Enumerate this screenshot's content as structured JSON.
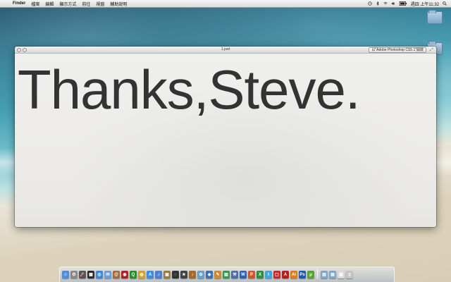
{
  "menubar": {
    "apple_glyph": "",
    "items": [
      "Finder",
      "檔案",
      "編輯",
      "顯示方式",
      "前往",
      "視窗",
      "輔助說明"
    ],
    "clock": "週四 上午11:32",
    "status_icons": [
      "wifi-icon",
      "volume-icon",
      "battery-icon",
      "bluetooth-icon",
      "time-machine-icon",
      "spotlight-icon"
    ]
  },
  "window": {
    "title": "1.psd",
    "open_with": "以\"Adobe Photoshop CS5.1\"開啟",
    "fullscreen_glyph": "⤢",
    "content_text": "Thanks,Steve."
  },
  "dock": {
    "icons": [
      {
        "name": "finder-icon",
        "color": "#4f8fd9",
        "glyph": "☺"
      },
      {
        "name": "system-preferences-icon",
        "color": "#8a8a8a",
        "glyph": "⚙"
      },
      {
        "name": "launchpad-icon",
        "color": "#555555",
        "glyph": "🚀"
      },
      {
        "name": "mission-control-icon",
        "color": "#2d2d2d",
        "glyph": "▦"
      },
      {
        "name": "safari-icon",
        "color": "#3b88d8",
        "glyph": "◎"
      },
      {
        "name": "mail-icon",
        "color": "#6d9ed6",
        "glyph": "✉"
      },
      {
        "name": "address-book-icon",
        "color": "#a36b3c",
        "glyph": "@"
      },
      {
        "name": "photo-booth-icon",
        "color": "#b32020",
        "glyph": "◉"
      },
      {
        "name": "qq-icon",
        "color": "#2c8e2c",
        "glyph": "Q"
      },
      {
        "name": "chrome-icon",
        "color": "#d6a12a",
        "glyph": "◍"
      },
      {
        "name": "app-store-icon",
        "color": "#3c8ee0",
        "glyph": "A"
      },
      {
        "name": "itunes-icon",
        "color": "#4a7fd1",
        "glyph": "♫"
      },
      {
        "name": "preview-icon",
        "color": "#9b7b3c",
        "glyph": "▣"
      },
      {
        "name": "aperture-icon",
        "color": "#333333",
        "glyph": "◌"
      },
      {
        "name": "imovie-icon",
        "color": "#444444",
        "glyph": "★"
      },
      {
        "name": "garageband-icon",
        "color": "#a36b2a",
        "glyph": "♪"
      },
      {
        "name": "iphoto-icon",
        "color": "#6aa0c8",
        "glyph": "✿"
      },
      {
        "name": "keynote-icon",
        "color": "#3d6fb3",
        "glyph": "◆"
      },
      {
        "name": "pages-icon",
        "color": "#cf8a2f",
        "glyph": "✎"
      },
      {
        "name": "numbers-icon",
        "color": "#3a9a4c",
        "glyph": "▤"
      },
      {
        "name": "xcode-icon",
        "color": "#4f6ea8",
        "glyph": "⚒"
      },
      {
        "name": "word-icon",
        "color": "#2a62b8",
        "glyph": "W"
      },
      {
        "name": "powerpoint-icon",
        "color": "#d0552a",
        "glyph": "P"
      },
      {
        "name": "excel-icon",
        "color": "#2f8f3f",
        "glyph": "X"
      },
      {
        "name": "twitter-icon",
        "color": "#3fa7dc",
        "glyph": "t"
      },
      {
        "name": "cal-icon",
        "color": "#c82828",
        "glyph": "▢"
      },
      {
        "name": "acrobat-icon",
        "color": "#b51c1c",
        "glyph": "A"
      },
      {
        "name": "illustrator-icon",
        "color": "#e07b14",
        "glyph": "Ai"
      },
      {
        "name": "photoshop-icon",
        "color": "#1f5ba8",
        "glyph": "Ps"
      },
      {
        "name": "utorrent-icon",
        "color": "#55a630",
        "glyph": "μ"
      },
      {
        "name": "separator",
        "color": "",
        "glyph": ""
      },
      {
        "name": "applications-folder-icon",
        "color": "#7fa7c7",
        "glyph": "▥"
      },
      {
        "name": "documents-folder-icon",
        "color": "#7fa7c7",
        "glyph": "▤"
      },
      {
        "name": "downloads-stack-icon",
        "color": "#d9d9d9",
        "glyph": "▧"
      },
      {
        "name": "trash-icon",
        "color": "#c4c4c4",
        "glyph": "▯"
      }
    ]
  }
}
